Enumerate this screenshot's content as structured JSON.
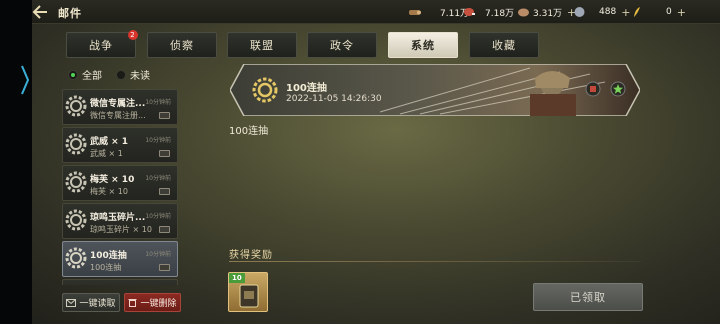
{
  "header": {
    "title": "邮件",
    "resources": [
      {
        "icon": "wood-icon",
        "value": "7.11万"
      },
      {
        "icon": "meat-icon",
        "value": "7.18万"
      },
      {
        "icon": "stone-icon",
        "value": "3.31万"
      },
      {
        "icon": "silver-icon",
        "value": "488"
      },
      {
        "icon": "gold-feather-icon",
        "value": "0"
      }
    ]
  },
  "tabs": [
    {
      "label": "战争",
      "badge": "2"
    },
    {
      "label": "侦察"
    },
    {
      "label": "联盟"
    },
    {
      "label": "政令"
    },
    {
      "label": "系统",
      "active": true
    },
    {
      "label": "收藏"
    }
  ],
  "filters": {
    "all": "全部",
    "unread": "未读"
  },
  "mails": [
    {
      "title": "微信专属注...",
      "time": "10分钟前",
      "subtitle": "微信专属注册..."
    },
    {
      "title": "武威 × 1",
      "time": "10分钟前",
      "subtitle": "武威 × 1"
    },
    {
      "title": "梅芙 × 10",
      "time": "10分钟前",
      "subtitle": "梅芙 × 10"
    },
    {
      "title": "琼鸣玉碎片...",
      "time": "10分钟前",
      "subtitle": "琼鸣玉碎片 × 10"
    },
    {
      "title": "100连抽",
      "time": "10分钟前",
      "subtitle": "100连抽"
    }
  ],
  "actions": {
    "read_all": "一键读取",
    "delete_all": "一键删除"
  },
  "detail": {
    "title": "100连抽",
    "datetime": "2022-11-05 14:26:30",
    "body": "100连抽",
    "reward_heading": "获得奖励",
    "reward_badge": "10",
    "claimed_label": "已领取"
  },
  "colors": {
    "accent_green": "#52d256",
    "badge_red": "#d9342c",
    "delete_red": "#8b2a22",
    "gold": "#caa865"
  }
}
